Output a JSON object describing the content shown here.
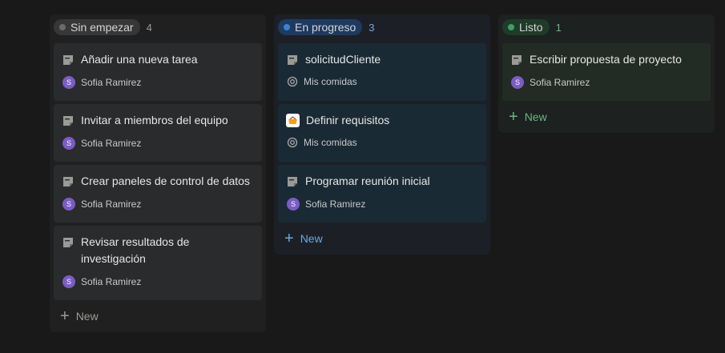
{
  "columns": [
    {
      "label": "Sin empezar",
      "count": "4",
      "pill_bg": "#373737",
      "dot_color": "#6b6b6b",
      "col_bg": "#202020",
      "card_bg": "#2a2b2c",
      "accent": "#9b9a97",
      "new_label": "New",
      "cards": [
        {
          "title": "Añadir una nueva tarea",
          "meta": "Sofia Ramirez",
          "avatar": "S"
        },
        {
          "title": "Invitar a miembros del equipo",
          "meta": "Sofia Ramirez",
          "avatar": "S"
        },
        {
          "title": "Crear paneles de control de datos",
          "meta": "Sofia Ramirez",
          "avatar": "S"
        },
        {
          "title": "Revisar resultados de investigación",
          "meta": "Sofia Ramirez",
          "avatar": "S"
        }
      ]
    },
    {
      "label": "En progreso",
      "count": "3",
      "pill_bg": "#1f3a5f",
      "dot_color": "#3b82d6",
      "col_bg": "#1c2026",
      "card_bg": "#1a2a35",
      "accent": "#6ea8dc",
      "new_label": "New",
      "cards": [
        {
          "title": "solicitudCliente",
          "meta": "Mis comidas",
          "avatar": ""
        },
        {
          "title": "Definir requisitos",
          "meta": "Mis comidas",
          "avatar": ""
        },
        {
          "title": "Programar reunión inicial",
          "meta": "Sofia Ramirez",
          "avatar": "S"
        }
      ]
    },
    {
      "label": "Listo",
      "count": "1",
      "pill_bg": "#1f3b2a",
      "dot_color": "#3f9e63",
      "col_bg": "#1d2120",
      "card_bg": "#222c25",
      "accent": "#66b885",
      "new_label": "New",
      "cards": [
        {
          "title": "Escribir propuesta de proyecto",
          "meta": "Sofia Ramirez",
          "avatar": "S"
        }
      ]
    }
  ]
}
